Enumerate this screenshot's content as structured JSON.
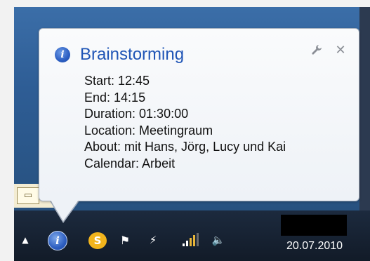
{
  "notification": {
    "title": "Brainstorming",
    "icon": "info-icon",
    "details": [
      "Start: 12:45",
      "End: 14:15",
      "Duration: 01:30:00",
      "Location: Meetingraum",
      "About: mit Hans, Jörg, Lucy und Kai",
      "Calendar: Arbeit"
    ],
    "controls": [
      "wrench-icon",
      "close-icon"
    ]
  },
  "taskbar": {
    "tray_icons": [
      "show-hidden-icons-arrow",
      "info-icon",
      "skype-icon",
      "action-center-flag-icon",
      "power-icon",
      "network-signal-icon",
      "volume-icon"
    ],
    "date": "20.07.2010"
  },
  "colors": {
    "title_blue": "#1f55b6",
    "taskbar": "#121b28",
    "desktop_blue": "#2e5d95"
  }
}
